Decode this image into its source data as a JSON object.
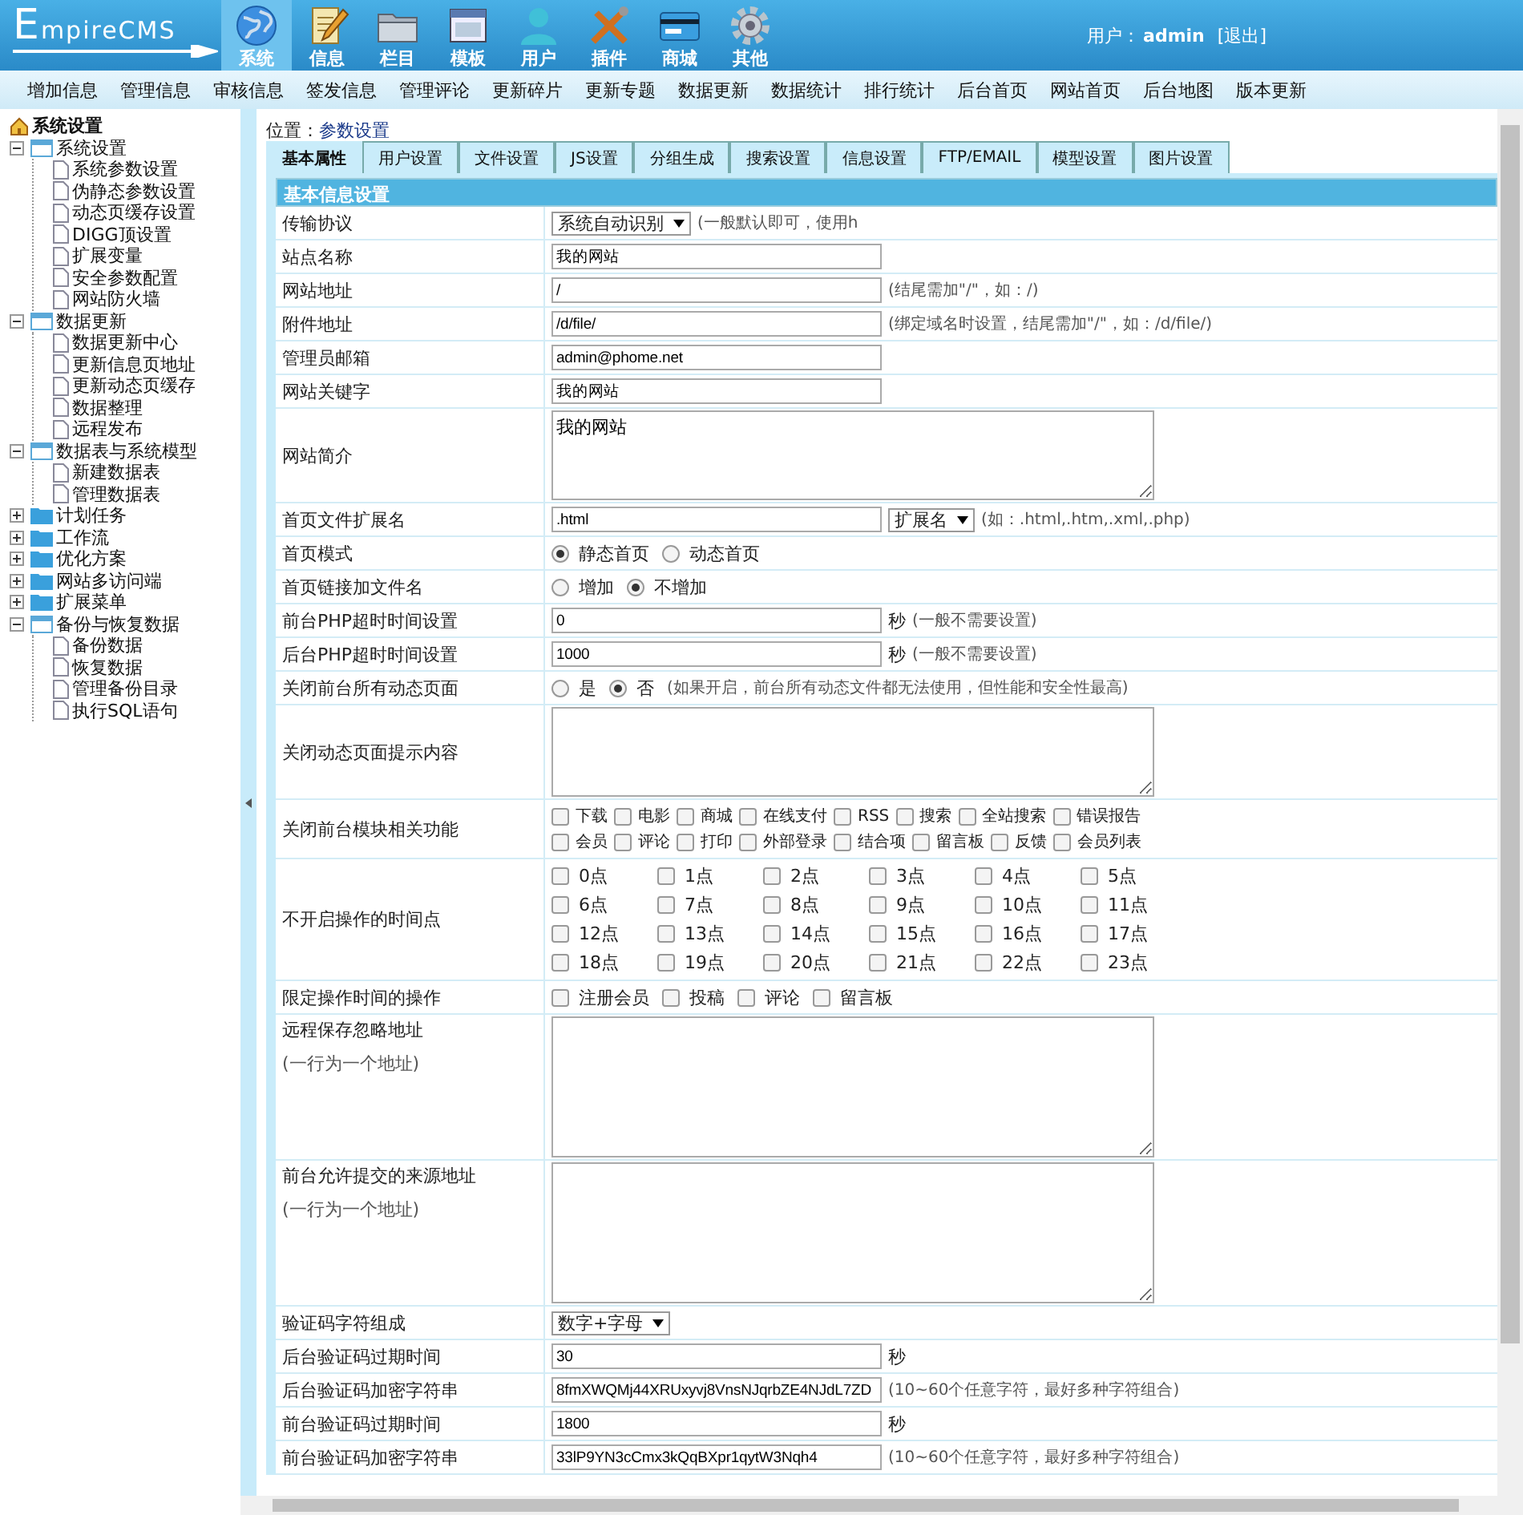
{
  "logo": {
    "text": "EmpireCMS"
  },
  "nav": [
    {
      "label": "系统",
      "kind": "globe",
      "selected": true
    },
    {
      "label": "信息",
      "kind": "pencil",
      "selected": false
    },
    {
      "label": "栏目",
      "kind": "folder",
      "selected": false
    },
    {
      "label": "模板",
      "kind": "window",
      "selected": false
    },
    {
      "label": "用户",
      "kind": "person",
      "selected": false
    },
    {
      "label": "插件",
      "kind": "tools",
      "selected": false
    },
    {
      "label": "商城",
      "kind": "card",
      "selected": false
    },
    {
      "label": "其他",
      "kind": "gear",
      "selected": false
    }
  ],
  "user": {
    "prefix": "用户：",
    "name": "admin",
    "logout": "[退出]"
  },
  "submenu": [
    "增加信息",
    "管理信息",
    "审核信息",
    "签发信息",
    "管理评论",
    "更新碎片",
    "更新专题",
    "数据更新",
    "数据统计",
    "排行统计",
    "后台首页",
    "网站首页",
    "后台地图",
    "版本更新"
  ],
  "tree": {
    "label": "系统设置",
    "children": [
      {
        "label": "系统设置",
        "expanded": true,
        "children": [
          "系统参数设置",
          "伪静态参数设置",
          "动态页缓存设置",
          "DIGG顶设置",
          "扩展变量",
          "安全参数配置",
          "网站防火墙"
        ]
      },
      {
        "label": "数据更新",
        "expanded": true,
        "children": [
          "数据更新中心",
          "更新信息页地址",
          "更新动态页缓存",
          "数据整理",
          "远程发布"
        ]
      },
      {
        "label": "数据表与系统模型",
        "expanded": true,
        "children": [
          "新建数据表",
          "管理数据表"
        ]
      },
      {
        "label": "计划任务",
        "expanded": false
      },
      {
        "label": "工作流",
        "expanded": false
      },
      {
        "label": "优化方案",
        "expanded": false
      },
      {
        "label": "网站多访问端",
        "expanded": false
      },
      {
        "label": "扩展菜单",
        "expanded": false
      },
      {
        "label": "备份与恢复数据",
        "expanded": true,
        "children": [
          "备份数据",
          "恢复数据",
          "管理备份目录",
          "执行SQL语句"
        ]
      }
    ]
  },
  "breadcrumb": {
    "prefix": "位置：",
    "page": "参数设置"
  },
  "tabs": [
    {
      "label": "基本属性",
      "selected": true
    },
    {
      "label": "用户设置",
      "selected": false
    },
    {
      "label": "文件设置",
      "selected": false
    },
    {
      "label": "JS设置",
      "selected": false
    },
    {
      "label": "分组生成",
      "selected": false
    },
    {
      "label": "搜索设置",
      "selected": false
    },
    {
      "label": "信息设置",
      "selected": false
    },
    {
      "label": "FTP/EMAIL",
      "selected": false
    },
    {
      "label": "模型设置",
      "selected": false
    },
    {
      "label": "图片设置",
      "selected": false
    }
  ],
  "section_title": "基本信息设置",
  "rows": [
    {
      "label": "传输协议",
      "controls": [
        {
          "kind": "select",
          "value": "系统自动识别"
        },
        {
          "kind": "hint",
          "text": "(一般默认即可，使用h"
        }
      ]
    },
    {
      "label": "站点名称",
      "controls": [
        {
          "kind": "input",
          "value": "我的网站"
        }
      ]
    },
    {
      "label": "网站地址",
      "controls": [
        {
          "kind": "input",
          "value": "/"
        },
        {
          "kind": "hint",
          "text": "(结尾需加\"/\"，如：/)"
        }
      ]
    },
    {
      "label": "附件地址",
      "controls": [
        {
          "kind": "input",
          "value": "/d/file/"
        },
        {
          "kind": "hint",
          "text": "(绑定域名时设置，结尾需加\"/\"，如：/d/file/)"
        }
      ]
    },
    {
      "label": "管理员邮箱",
      "controls": [
        {
          "kind": "input",
          "value": "admin@phome.net"
        }
      ]
    },
    {
      "label": "网站关键字",
      "controls": [
        {
          "kind": "input",
          "value": "我的网站"
        }
      ]
    },
    {
      "label": "网站简介",
      "controls": [
        {
          "kind": "textarea",
          "value": "我的网站"
        }
      ]
    },
    {
      "label": "首页文件扩展名",
      "controls": [
        {
          "kind": "input",
          "value": ".html"
        },
        {
          "kind": "select",
          "value": "扩展名"
        },
        {
          "kind": "hint",
          "text": "(如：.html,.htm,.xml,.php)"
        }
      ]
    },
    {
      "label": "首页模式",
      "controls": [
        {
          "kind": "radio",
          "label": "静态首页",
          "selected": true
        },
        {
          "kind": "radio",
          "label": "动态首页",
          "selected": false
        }
      ]
    },
    {
      "label": "首页链接加文件名",
      "controls": [
        {
          "kind": "radio",
          "label": "增加",
          "selected": false
        },
        {
          "kind": "radio",
          "label": "不增加",
          "selected": true
        }
      ]
    },
    {
      "label": "前台PHP超时时间设置",
      "controls": [
        {
          "kind": "input",
          "value": "0"
        },
        {
          "kind": "unit",
          "text": "秒"
        },
        {
          "kind": "hint",
          "text": "(一般不需要设置)"
        }
      ]
    },
    {
      "label": "后台PHP超时时间设置",
      "controls": [
        {
          "kind": "input",
          "value": "1000"
        },
        {
          "kind": "unit",
          "text": "秒"
        },
        {
          "kind": "hint",
          "text": "(一般不需要设置)"
        }
      ]
    },
    {
      "label": "关闭前台所有动态页面",
      "controls": [
        {
          "kind": "radio",
          "label": "是",
          "selected": false
        },
        {
          "kind": "radio",
          "label": "否",
          "selected": true
        },
        {
          "kind": "hint",
          "text": "(如果开启，前台所有动态文件都无法使用，但性能和安全性最高)"
        }
      ]
    },
    {
      "label": "关闭动态页面提示内容",
      "controls": [
        {
          "kind": "textarea"
        }
      ]
    },
    {
      "label": "关闭前台模块相关功能",
      "kind": "flow",
      "controls": [
        {
          "kind": "checkbox",
          "label": "下载",
          "checked": false
        },
        {
          "kind": "checkbox",
          "label": "电影",
          "checked": false
        },
        {
          "kind": "checkbox",
          "label": "商城",
          "checked": false
        },
        {
          "kind": "checkbox",
          "label": "在线支付",
          "checked": false
        },
        {
          "kind": "checkbox",
          "label": "RSS",
          "checked": false
        },
        {
          "kind": "checkbox",
          "label": "搜索",
          "checked": false
        },
        {
          "kind": "checkbox",
          "label": "全站搜索",
          "checked": false
        },
        {
          "kind": "checkbox",
          "label": "错误报告",
          "checked": false
        },
        {
          "kind": "checkbox",
          "label": "会员",
          "checked": false
        },
        {
          "kind": "checkbox",
          "label": "评论",
          "checked": false
        },
        {
          "kind": "checkbox",
          "label": "打印",
          "checked": false
        },
        {
          "kind": "checkbox",
          "label": "外部登录",
          "checked": false
        },
        {
          "kind": "checkbox",
          "label": "结合项",
          "checked": false
        },
        {
          "kind": "checkbox",
          "label": "留言板",
          "checked": false
        },
        {
          "kind": "checkbox",
          "label": "反馈",
          "checked": false
        },
        {
          "kind": "checkbox",
          "label": "会员列表",
          "checked": false
        }
      ]
    },
    {
      "label": "不开启操作的时间点",
      "kind": "grid",
      "controls": [
        {
          "kind": "checkbox",
          "label": "0点",
          "checked": false
        },
        {
          "kind": "checkbox",
          "label": "1点",
          "checked": false
        },
        {
          "kind": "checkbox",
          "label": "2点",
          "checked": false
        },
        {
          "kind": "checkbox",
          "label": "3点",
          "checked": false
        },
        {
          "kind": "checkbox",
          "label": "4点",
          "checked": false
        },
        {
          "kind": "checkbox",
          "label": "5点",
          "checked": false
        },
        {
          "kind": "checkbox",
          "label": "6点",
          "checked": false
        },
        {
          "kind": "checkbox",
          "label": "7点",
          "checked": false
        },
        {
          "kind": "checkbox",
          "label": "8点",
          "checked": false
        },
        {
          "kind": "checkbox",
          "label": "9点",
          "checked": false
        },
        {
          "kind": "checkbox",
          "label": "10点",
          "checked": false
        },
        {
          "kind": "checkbox",
          "label": "11点",
          "checked": false
        },
        {
          "kind": "checkbox",
          "label": "12点",
          "checked": false
        },
        {
          "kind": "checkbox",
          "label": "13点",
          "checked": false
        },
        {
          "kind": "checkbox",
          "label": "14点",
          "checked": false
        },
        {
          "kind": "checkbox",
          "label": "15点",
          "checked": false
        },
        {
          "kind": "checkbox",
          "label": "16点",
          "checked": false
        },
        {
          "kind": "checkbox",
          "label": "17点",
          "checked": false
        },
        {
          "kind": "checkbox",
          "label": "18点",
          "checked": false
        },
        {
          "kind": "checkbox",
          "label": "19点",
          "checked": false
        },
        {
          "kind": "checkbox",
          "label": "20点",
          "checked": false
        },
        {
          "kind": "checkbox",
          "label": "21点",
          "checked": false
        },
        {
          "kind": "checkbox",
          "label": "22点",
          "checked": false
        },
        {
          "kind": "checkbox",
          "label": "23点",
          "checked": false
        }
      ]
    },
    {
      "label": "限定操作时间的操作",
      "controls": [
        {
          "kind": "checkbox",
          "label": "注册会员",
          "checked": false
        },
        {
          "kind": "checkbox",
          "label": "投稿",
          "checked": false
        },
        {
          "kind": "checkbox",
          "label": "评论",
          "checked": false
        },
        {
          "kind": "checkbox",
          "label": "留言板",
          "checked": false
        }
      ]
    },
    {
      "label": "远程保存忽略地址",
      "note": "(一行为一个地址)",
      "controls": [
        {
          "kind": "textarea"
        }
      ]
    },
    {
      "label": "前台允许提交的来源地址",
      "note": "(一行为一个地址)",
      "controls": [
        {
          "kind": "textarea"
        }
      ]
    },
    {
      "label": "验证码字符组成",
      "controls": [
        {
          "kind": "select",
          "value": "数字+字母"
        }
      ]
    },
    {
      "label": "后台验证码过期时间",
      "controls": [
        {
          "kind": "input",
          "value": "30"
        },
        {
          "kind": "unit",
          "text": "秒"
        }
      ]
    },
    {
      "label": "后台验证码加密字符串",
      "controls": [
        {
          "kind": "input",
          "value": "8fmXWQMj44XRUxyvj8VnsNJqrbZE4NJdL7ZD"
        },
        {
          "kind": "hint",
          "text": "(10~60个任意字符，最好多种字符组合)"
        }
      ]
    },
    {
      "label": "前台验证码过期时间",
      "controls": [
        {
          "kind": "input",
          "value": "1800"
        },
        {
          "kind": "unit",
          "text": "秒"
        }
      ]
    },
    {
      "label": "前台验证码加密字符串",
      "controls": [
        {
          "kind": "input",
          "value": "33lP9YN3cCmx3kQqBXpr1qytW3Nqh4"
        },
        {
          "kind": "hint",
          "text": "(10~60个任意字符，最好多种字符组合)"
        }
      ]
    }
  ]
}
